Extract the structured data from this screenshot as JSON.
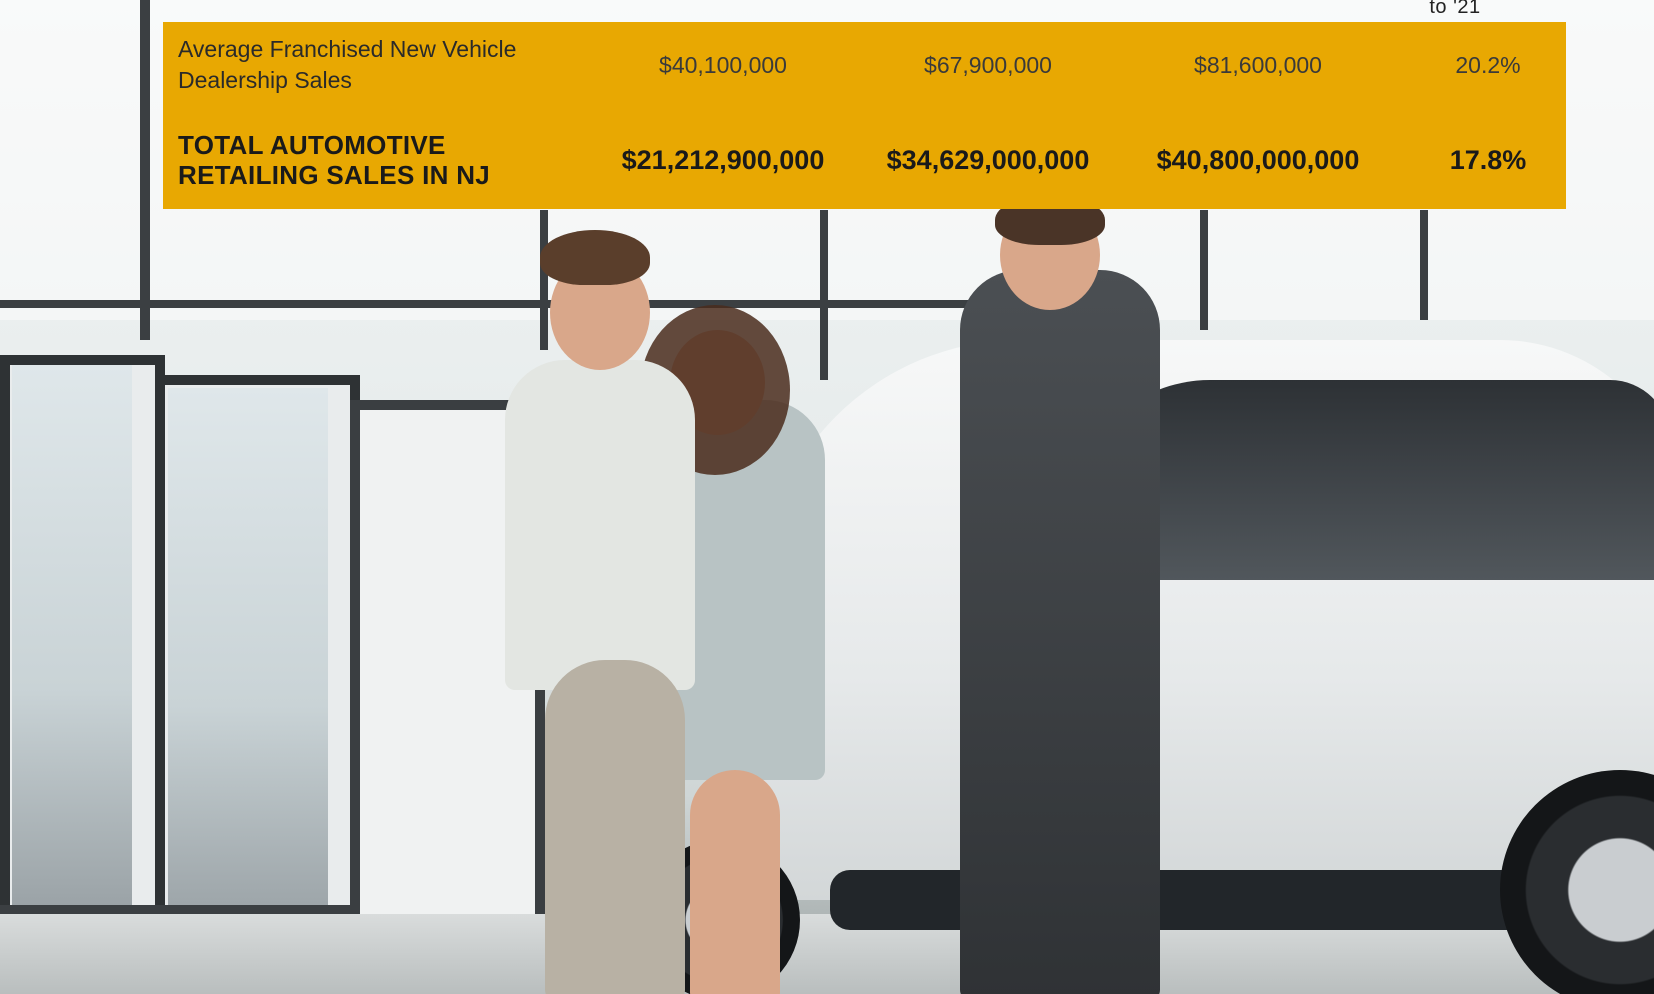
{
  "header": {
    "partial_column_label": "to '21"
  },
  "table": {
    "rows": [
      {
        "label": "Average Franchised New Vehicle Dealership Sales",
        "values": [
          "$40,100,000",
          "$67,900,000",
          "$81,600,000",
          "20.2%"
        ],
        "emphasis": false
      },
      {
        "label": "TOTAL AUTOMOTIVE RETAILING SALES IN NJ",
        "values": [
          "$21,212,900,000",
          "$34,629,000,000",
          "$40,800,000,000",
          "17.8%"
        ],
        "emphasis": true
      }
    ]
  },
  "colors": {
    "panel": "#e8a802",
    "text": "#2a2a2a"
  },
  "photo": {
    "subject": "dealership-handshake-photo"
  }
}
